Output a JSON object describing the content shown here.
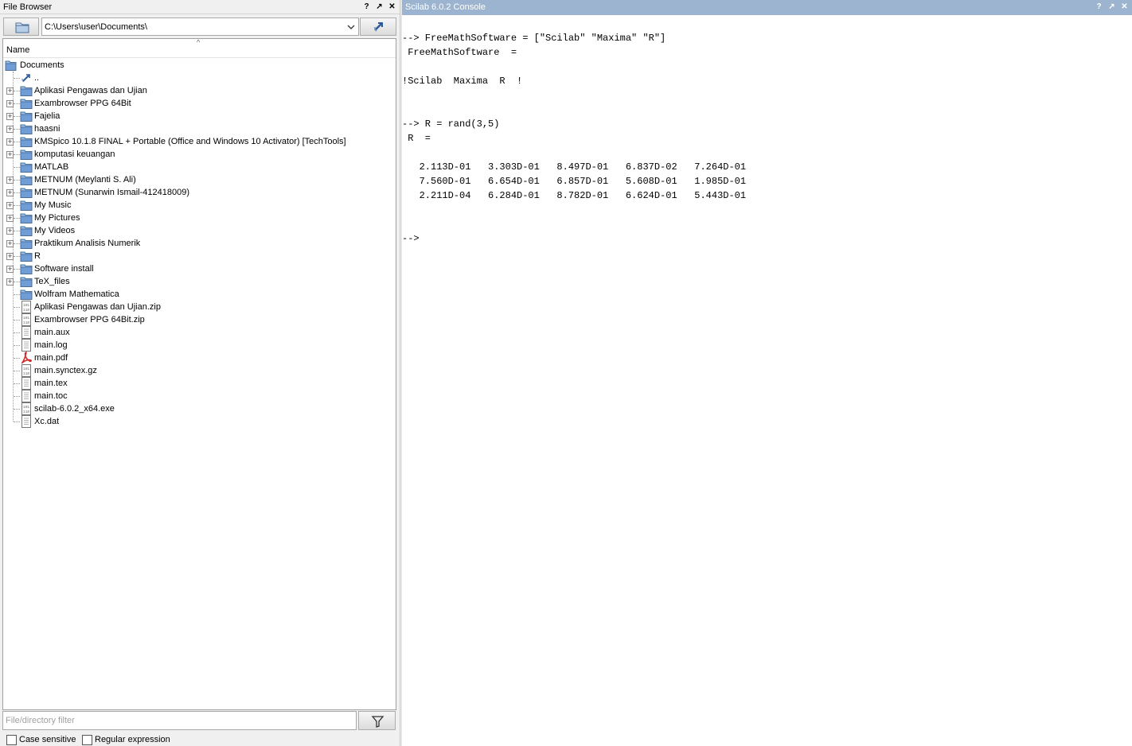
{
  "file_browser": {
    "title": "File Browser",
    "path": "C:\\Users\\user\\Documents\\",
    "column_name": "Name",
    "root": "Documents",
    "items": [
      {
        "label": "..",
        "kind": "up",
        "expandable": false
      },
      {
        "label": "Aplikasi Pengawas dan Ujian",
        "kind": "folder",
        "expandable": true
      },
      {
        "label": "Exambrowser PPG 64Bit",
        "kind": "folder",
        "expandable": true
      },
      {
        "label": "Fajelia",
        "kind": "folder",
        "expandable": true
      },
      {
        "label": "haasni",
        "kind": "folder",
        "expandable": true
      },
      {
        "label": "KMSpico 10.1.8 FINAL + Portable (Office and Windows 10 Activator) [TechTools]",
        "kind": "folder",
        "expandable": true
      },
      {
        "label": "komputasi keuangan",
        "kind": "folder",
        "expandable": true
      },
      {
        "label": "MATLAB",
        "kind": "folder",
        "expandable": false
      },
      {
        "label": "METNUM (Meylanti S. Ali)",
        "kind": "folder",
        "expandable": true
      },
      {
        "label": "METNUM (Sunarwin Ismail-412418009)",
        "kind": "folder",
        "expandable": true
      },
      {
        "label": "My Music",
        "kind": "folder",
        "expandable": true
      },
      {
        "label": "My Pictures",
        "kind": "folder",
        "expandable": true
      },
      {
        "label": "My Videos",
        "kind": "folder",
        "expandable": true
      },
      {
        "label": "Praktikum Analisis Numerik",
        "kind": "folder",
        "expandable": true
      },
      {
        "label": "R",
        "kind": "folder",
        "expandable": true
      },
      {
        "label": "Software install",
        "kind": "folder",
        "expandable": true
      },
      {
        "label": "TeX_files",
        "kind": "folder",
        "expandable": true
      },
      {
        "label": "Wolfram Mathematica",
        "kind": "folder",
        "expandable": false
      },
      {
        "label": "Aplikasi Pengawas dan Ujian.zip",
        "kind": "binary",
        "expandable": false
      },
      {
        "label": "Exambrowser PPG 64Bit.zip",
        "kind": "binary",
        "expandable": false
      },
      {
        "label": "main.aux",
        "kind": "text",
        "expandable": false
      },
      {
        "label": "main.log",
        "kind": "text",
        "expandable": false
      },
      {
        "label": "main.pdf",
        "kind": "pdf",
        "expandable": false
      },
      {
        "label": "main.synctex.gz",
        "kind": "binary",
        "expandable": false
      },
      {
        "label": "main.tex",
        "kind": "text",
        "expandable": false
      },
      {
        "label": "main.toc",
        "kind": "text",
        "expandable": false
      },
      {
        "label": "scilab-6.0.2_x64.exe",
        "kind": "binary",
        "expandable": false
      },
      {
        "label": "Xc.dat",
        "kind": "text",
        "expandable": false
      }
    ],
    "filter_placeholder": "File/directory filter",
    "case_sensitive_label": "Case sensitive",
    "regex_label": "Regular expression",
    "case_sensitive_checked": false,
    "regex_checked": false
  },
  "console": {
    "title": "Scilab 6.0.2 Console",
    "lines": [
      "--> FreeMathSoftware = [\"Scilab\" \"Maxima\" \"R\"]",
      " FreeMathSoftware  =",
      "",
      "!Scilab  Maxima  R  !",
      "",
      "",
      "--> R = rand(3,5)",
      " R  =",
      "",
      "   2.113D-01   3.303D-01   8.497D-01   6.837D-02   7.264D-01",
      "   7.560D-01   6.654D-01   6.857D-01   5.608D-01   1.985D-01",
      "   2.211D-04   6.284D-01   8.782D-01   6.624D-01   5.443D-01",
      "",
      "",
      "-->"
    ]
  },
  "colors": {
    "console_title_bg": "#9cb4cf",
    "folder_icon": "#6f9ed6",
    "pdf_icon": "#d42a2a"
  }
}
